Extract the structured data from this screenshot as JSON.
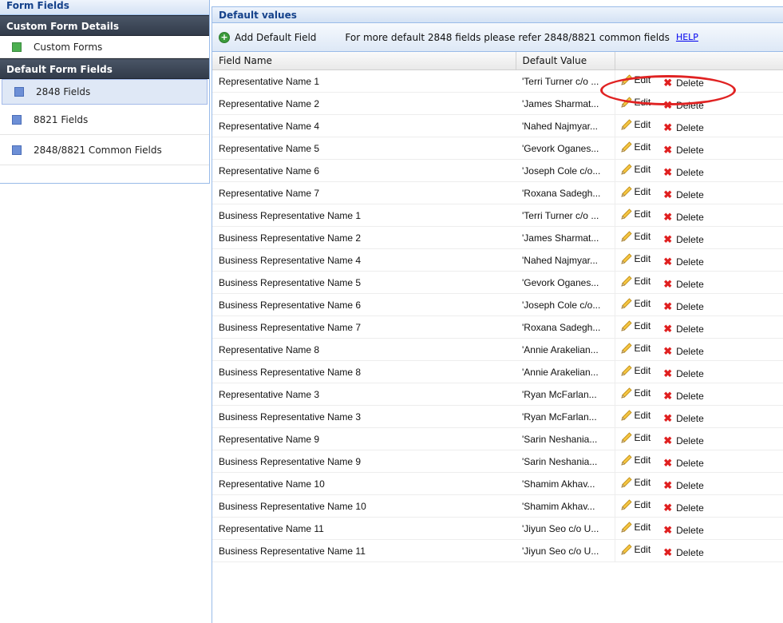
{
  "left_panel": {
    "title": "Form Fields",
    "custom_group": "Custom Form Details",
    "custom_items": [
      {
        "label": "Custom Forms"
      }
    ],
    "default_group": "Default Form Fields",
    "default_items": [
      {
        "label": "2848 Fields",
        "selected": true
      },
      {
        "label": "8821 Fields"
      },
      {
        "label": "2848/8821 Common Fields"
      }
    ]
  },
  "right_panel": {
    "title": "Default values",
    "toolbar": {
      "add_label": "Add Default Field",
      "note": "For more default 2848 fields please refer 2848/8821 common fields",
      "help_label": "HELP"
    },
    "columns": {
      "field_name": "Field Name",
      "default_value": "Default Value"
    },
    "actions": {
      "edit": "Edit",
      "delete": "Delete"
    },
    "rows": [
      {
        "field": "Representative Name 1",
        "value": "'Terri Turner c/o ..."
      },
      {
        "field": "Representative Name 2",
        "value": "'James Sharmat..."
      },
      {
        "field": "Representative Name 4",
        "value": "'Nahed Najmyar..."
      },
      {
        "field": "Representative Name 5",
        "value": "'Gevork Oganes..."
      },
      {
        "field": "Representative Name 6",
        "value": "'Joseph Cole c/o..."
      },
      {
        "field": "Representative Name 7",
        "value": "'Roxana Sadegh..."
      },
      {
        "field": "Business Representative Name 1",
        "value": "'Terri Turner c/o ..."
      },
      {
        "field": "Business Representative Name 2",
        "value": "'James Sharmat..."
      },
      {
        "field": "Business Representative Name 4",
        "value": "'Nahed Najmyar..."
      },
      {
        "field": "Business Representative Name 5",
        "value": "'Gevork Oganes..."
      },
      {
        "field": "Business Representative Name 6",
        "value": "'Joseph Cole c/o..."
      },
      {
        "field": "Business Representative Name 7",
        "value": "'Roxana Sadegh..."
      },
      {
        "field": "Representative Name 8",
        "value": "'Annie Arakelian..."
      },
      {
        "field": "Business Representative Name 8",
        "value": "'Annie Arakelian..."
      },
      {
        "field": "Representative Name 3",
        "value": "'Ryan McFarlan..."
      },
      {
        "field": "Business Representative Name 3",
        "value": "'Ryan McFarlan..."
      },
      {
        "field": "Representative Name 9",
        "value": "'Sarin Neshania..."
      },
      {
        "field": "Business Representative Name 9",
        "value": "'Sarin Neshania..."
      },
      {
        "field": "Representative Name 10",
        "value": "'Shamim Akhav..."
      },
      {
        "field": "Business Representative Name 10",
        "value": "'Shamim Akhav..."
      },
      {
        "field": "Representative Name 11",
        "value": "'Jiyun Seo c/o U..."
      },
      {
        "field": "Business Representative Name 11",
        "value": "'Jiyun Seo c/o U..."
      }
    ]
  },
  "colors": {
    "header_text": "#15428b",
    "delete_x": "#e02020",
    "annotation": "#e02222"
  }
}
